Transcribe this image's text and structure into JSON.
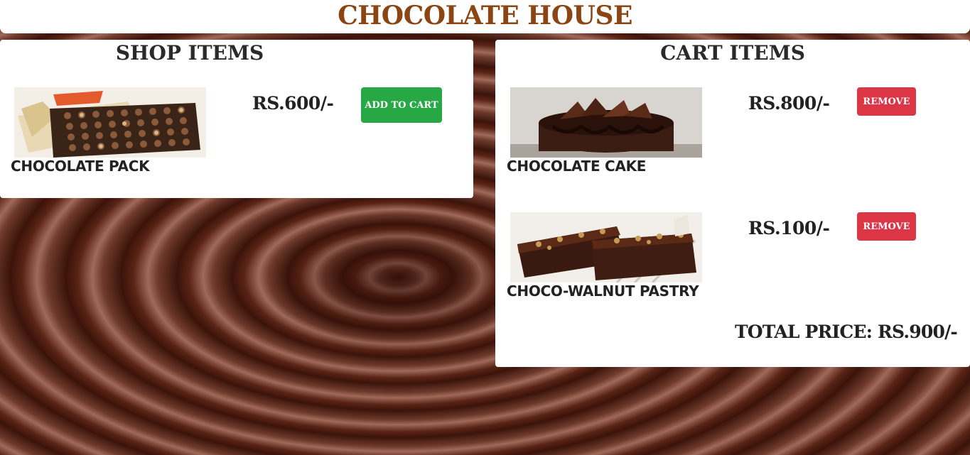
{
  "header": {
    "title": "CHOCOLATE HOUSE"
  },
  "shop": {
    "title": "SHOP ITEMS",
    "items": [
      {
        "name": "CHOCOLATE PACK",
        "price": "RS.600/-",
        "button": "ADD TO CART",
        "image": "chocolate-box-image"
      }
    ]
  },
  "cart": {
    "title": "CART ITEMS",
    "items": [
      {
        "name": "CHOCOLATE CAKE",
        "price": "RS.800/-",
        "button": "REMOVE",
        "image": "chocolate-cake-image"
      },
      {
        "name": "CHOCO-WALNUT PASTRY",
        "price": "RS.100/-",
        "button": "REMOVE",
        "image": "walnut-pastry-image"
      }
    ],
    "total": "TOTAL PRICE: RS.900/-"
  },
  "colors": {
    "title": "#8b4513",
    "add_button": "#28a745",
    "remove_button": "#dc3545",
    "background": "#4a1c10"
  }
}
